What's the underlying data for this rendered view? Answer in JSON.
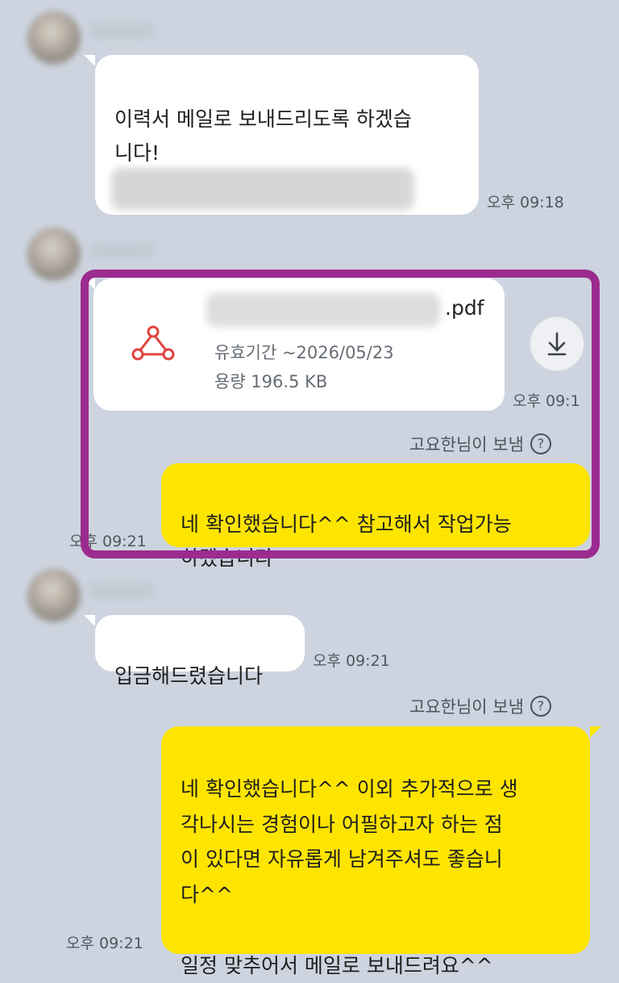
{
  "messages": {
    "m1_text": "이력서 메일로 보내드리도록 하겠습\n니다!",
    "m1_time": "오후 09:18",
    "file_ext": ".pdf",
    "file_expiry": "유효기간 ~2026/05/23",
    "file_size": "용량 196.5 KB",
    "file_time": "오후 09:1",
    "sent_by_1": "고요한님이 보냄",
    "m3_text": "네 확인했습니다^^ 참고해서 작업가능\n하겠습니다",
    "m3_time": "오후 09:21",
    "m4_text": "입금해드렸습니다",
    "m4_time": "오후 09:21",
    "sent_by_2": "고요한님이 보냄",
    "m5_text": "네 확인했습니다^^ 이외 추가적으로 생\n각나시는 경험이나 어필하고자 하는 점\n이 있다면 자유롭게 남겨주셔도 좋습니\n다^^\n\n일정 맞추어서 메일로 보내드려요^^",
    "m5_time": "오후 09:21"
  },
  "icons": {
    "file": "pdf-file-icon",
    "download": "download-icon",
    "help": "help-circle-icon"
  },
  "colors": {
    "background": "#cdd4df",
    "incoming_bubble": "#ffffff",
    "outgoing_bubble": "#fee500",
    "highlight": "#9c2b8f",
    "pdf_icon": "#e0443e"
  }
}
